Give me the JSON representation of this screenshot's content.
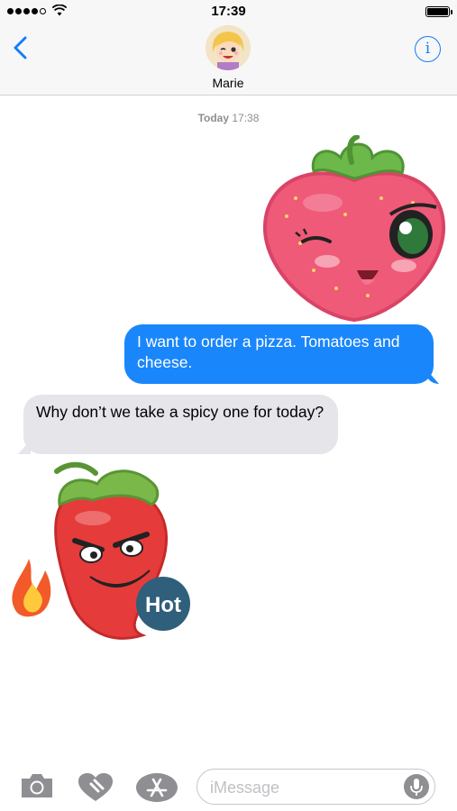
{
  "status_bar": {
    "time": "17:39",
    "signal_icon": "signal-dots-icon",
    "wifi_icon": "wifi-icon",
    "battery_icon": "battery-icon",
    "battery_level": 1.0
  },
  "nav": {
    "back_icon": "chevron-left-icon",
    "contact_name": "Marie",
    "info_icon": "info-icon",
    "info_glyph": "i"
  },
  "conversation": {
    "timestamp_day": "Today",
    "timestamp_time": "17:38",
    "stickers": [
      {
        "name": "strawberry-winking-sticker"
      },
      {
        "name": "chili-pepper-hot-sticker",
        "label": "Hot"
      }
    ],
    "messages": [
      {
        "direction": "outgoing",
        "text": "I want to order a pizza. Tomatoes and cheese."
      },
      {
        "direction": "incoming",
        "text": "Why don’t we take a spicy one for today?"
      }
    ]
  },
  "input_bar": {
    "camera_icon": "camera-icon",
    "digital_touch_icon": "digital-touch-heart-icon",
    "apps_icon": "app-store-icon",
    "placeholder": "iMessage",
    "mic_icon": "microphone-icon"
  },
  "colors": {
    "accent": "#147efb",
    "outgoing_bubble": "#1a86fb",
    "incoming_bubble": "#e5e5ea",
    "bar_background": "#f7f7f7"
  }
}
